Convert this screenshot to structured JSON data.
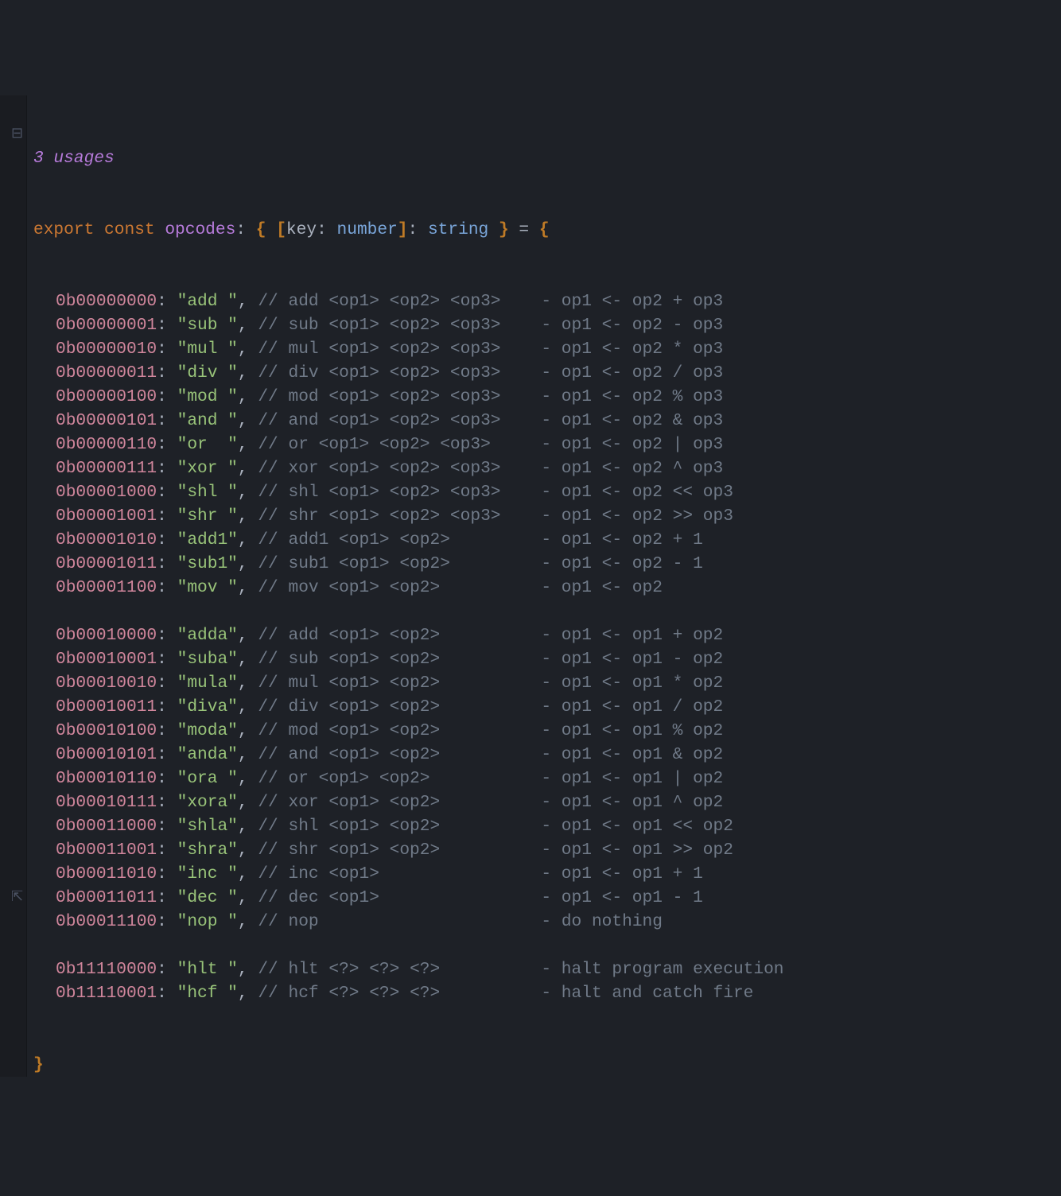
{
  "usages_hint": "3 usages",
  "decl": {
    "export": "export",
    "const": "const",
    "name": "opcodes",
    "colon": ":",
    "brace_open": "{",
    "brack_open": "[",
    "key_label": "key",
    "key_type": "number",
    "brack_close": "]",
    "val_type": "string",
    "brace_close": "}",
    "equals": "=",
    "open_obj": "{"
  },
  "close_obj": "}",
  "rows": [
    {
      "opcode": "0b00000000",
      "name": "add",
      "c1": "//",
      "sig": "add <op1> <op2> <op3>",
      "desc": "- op1 <- op2 + op3"
    },
    {
      "opcode": "0b00000001",
      "name": "sub",
      "c1": "//",
      "sig": "sub <op1> <op2> <op3>",
      "desc": "- op1 <- op2 - op3"
    },
    {
      "opcode": "0b00000010",
      "name": "mul",
      "c1": "//",
      "sig": "mul <op1> <op2> <op3>",
      "desc": "- op1 <- op2 * op3"
    },
    {
      "opcode": "0b00000011",
      "name": "div",
      "c1": "//",
      "sig": "div <op1> <op2> <op3>",
      "desc": "- op1 <- op2 / op3"
    },
    {
      "opcode": "0b00000100",
      "name": "mod",
      "c1": "//",
      "sig": "mod <op1> <op2> <op3>",
      "desc": "- op1 <- op2 % op3"
    },
    {
      "opcode": "0b00000101",
      "name": "and",
      "c1": "//",
      "sig": "and <op1> <op2> <op3>",
      "desc": "- op1 <- op2 & op3"
    },
    {
      "opcode": "0b00000110",
      "name": "or",
      "c1": "//",
      "sig": "or <op1> <op2> <op3>",
      "desc": "- op1 <- op2 | op3"
    },
    {
      "opcode": "0b00000111",
      "name": "xor",
      "c1": "//",
      "sig": "xor <op1> <op2> <op3>",
      "desc": "- op1 <- op2 ^ op3"
    },
    {
      "opcode": "0b00001000",
      "name": "shl",
      "c1": "//",
      "sig": "shl <op1> <op2> <op3>",
      "desc": "- op1 <- op2 << op3"
    },
    {
      "opcode": "0b00001001",
      "name": "shr",
      "c1": "//",
      "sig": "shr <op1> <op2> <op3>",
      "desc": "- op1 <- op2 >> op3"
    },
    {
      "opcode": "0b00001010",
      "name": "add1",
      "c1": "//",
      "sig": "add1 <op1> <op2>",
      "desc": "- op1 <- op2 + 1"
    },
    {
      "opcode": "0b00001011",
      "name": "sub1",
      "c1": "//",
      "sig": "sub1 <op1> <op2>",
      "desc": "- op1 <- op2 - 1"
    },
    {
      "opcode": "0b00001100",
      "name": "mov",
      "c1": "//",
      "sig": "mov <op1> <op2>",
      "desc": "- op1 <- op2"
    },
    {
      "blank": true
    },
    {
      "opcode": "0b00010000",
      "name": "adda",
      "c1": "//",
      "sig": "add <op1> <op2>",
      "desc": "- op1 <- op1 + op2"
    },
    {
      "opcode": "0b00010001",
      "name": "suba",
      "c1": "//",
      "sig": "sub <op1> <op2>",
      "desc": "- op1 <- op1 - op2"
    },
    {
      "opcode": "0b00010010",
      "name": "mula",
      "c1": "//",
      "sig": "mul <op1> <op2>",
      "desc": "- op1 <- op1 * op2"
    },
    {
      "opcode": "0b00010011",
      "name": "diva",
      "c1": "//",
      "sig": "div <op1> <op2>",
      "desc": "- op1 <- op1 / op2"
    },
    {
      "opcode": "0b00010100",
      "name": "moda",
      "c1": "//",
      "sig": "mod <op1> <op2>",
      "desc": "- op1 <- op1 % op2"
    },
    {
      "opcode": "0b00010101",
      "name": "anda",
      "c1": "//",
      "sig": "and <op1> <op2>",
      "desc": "- op1 <- op1 & op2"
    },
    {
      "opcode": "0b00010110",
      "name": "ora",
      "c1": "//",
      "sig": "or <op1> <op2>",
      "desc": "- op1 <- op1 | op2"
    },
    {
      "opcode": "0b00010111",
      "name": "xora",
      "c1": "//",
      "sig": "xor <op1> <op2>",
      "desc": "- op1 <- op1 ^ op2"
    },
    {
      "opcode": "0b00011000",
      "name": "shla",
      "c1": "//",
      "sig": "shl <op1> <op2>",
      "desc": "- op1 <- op1 << op2"
    },
    {
      "opcode": "0b00011001",
      "name": "shra",
      "c1": "//",
      "sig": "shr <op1> <op2>",
      "desc": "- op1 <- op1 >> op2"
    },
    {
      "opcode": "0b00011010",
      "name": "inc",
      "c1": "//",
      "sig": "inc <op1>",
      "desc": "- op1 <- op1 + 1"
    },
    {
      "opcode": "0b00011011",
      "name": "dec",
      "c1": "//",
      "sig": "dec <op1>",
      "desc": "- op1 <- op1 - 1"
    },
    {
      "opcode": "0b00011100",
      "name": "nop",
      "c1": "//",
      "sig": "nop",
      "desc": "- do nothing"
    },
    {
      "blank": true
    },
    {
      "opcode": "0b11110000",
      "name": "hlt",
      "c1": "//",
      "sig": "hlt <?> <?> <?>",
      "desc": "- halt program execution"
    },
    {
      "opcode": "0b11110001",
      "name": "hcf",
      "c1": "//",
      "sig": "hcf <?> <?> <?>",
      "desc": "- halt and catch fire"
    }
  ]
}
